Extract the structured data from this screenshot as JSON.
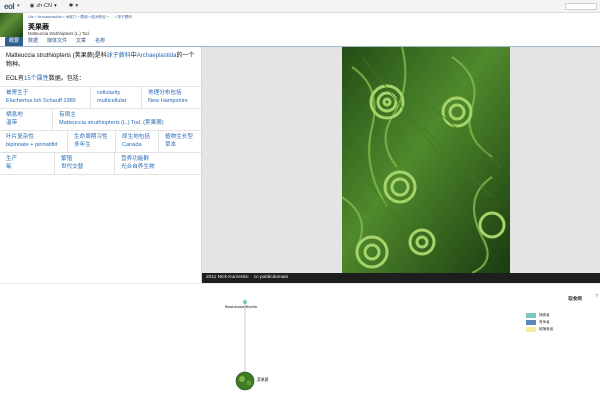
{
  "topbar": {
    "logo": "eol",
    "language": "zh-CN"
  },
  "header": {
    "breadcrumb": [
      "Life",
      "Archaeplastida",
      "木贼门",
      "蕨纲",
      "欧洲桦目",
      "…",
      "球子蕨科"
    ],
    "name_cn": "荚果蕨",
    "name_sci": "Matteuccia struthiopteris (L.) Tod."
  },
  "tabs": [
    {
      "label": "概要",
      "active": true
    },
    {
      "label": "数据",
      "active": false
    },
    {
      "label": "媒体文件",
      "active": false
    },
    {
      "label": "文章",
      "active": false
    },
    {
      "label": "名称",
      "active": false
    }
  ],
  "summary": {
    "intro_1": "Matteuccia struthiopteris (荚果蕨)是科",
    "intro_link_1": "球子蕨科",
    "intro_2": "中",
    "intro_link_2": "Archaeplastida",
    "intro_3": "的一个物种。",
    "count_pre": "EOL有",
    "count_link": "15个属性",
    "count_post": "数据。包括："
  },
  "traits": [
    [
      {
        "key": "被寄生于",
        "value": "Elachertus loh Schauff 1985"
      },
      {
        "key": "cellularity",
        "value": "multicellular"
      },
      {
        "key": "地理分布包括",
        "value": "New Hampshire"
      }
    ],
    [
      {
        "key": "栖息地",
        "value": "温带"
      },
      {
        "key": "有宿主",
        "value": "Matteuccia struthiopteris (L.) Tod. (荚果蕨)"
      }
    ],
    [
      {
        "key": "叶片复杂性",
        "value": "bipinnate + pinnatifid"
      },
      {
        "key": "生命周期习性",
        "value": "多年生"
      },
      {
        "key": "原生地包括",
        "value": "Canada"
      },
      {
        "key": "植物生长型",
        "value": "草本"
      }
    ],
    [
      {
        "key": "生产",
        "value": "氧"
      },
      {
        "key": "繁殖",
        "value": "世代交替"
      },
      {
        "key": "营养功能群",
        "value": "光合自养生物"
      }
    ]
  ],
  "media": {
    "caption_year_author": "2011 Nick Kurzenko",
    "caption_license": "cc-publicdomain"
  },
  "tree": {
    "legend_title": "取食网",
    "legend": [
      {
        "label": "捕食者",
        "color": "#7ec6c0"
      },
      {
        "label": "竞争者",
        "color": "#5b88b8"
      },
      {
        "label": "被捕食者",
        "color": "#f2ee9a"
      }
    ],
    "top_node": "Blastobasis filicella",
    "bottom_node": "荚果蕨",
    "corner": "?"
  }
}
